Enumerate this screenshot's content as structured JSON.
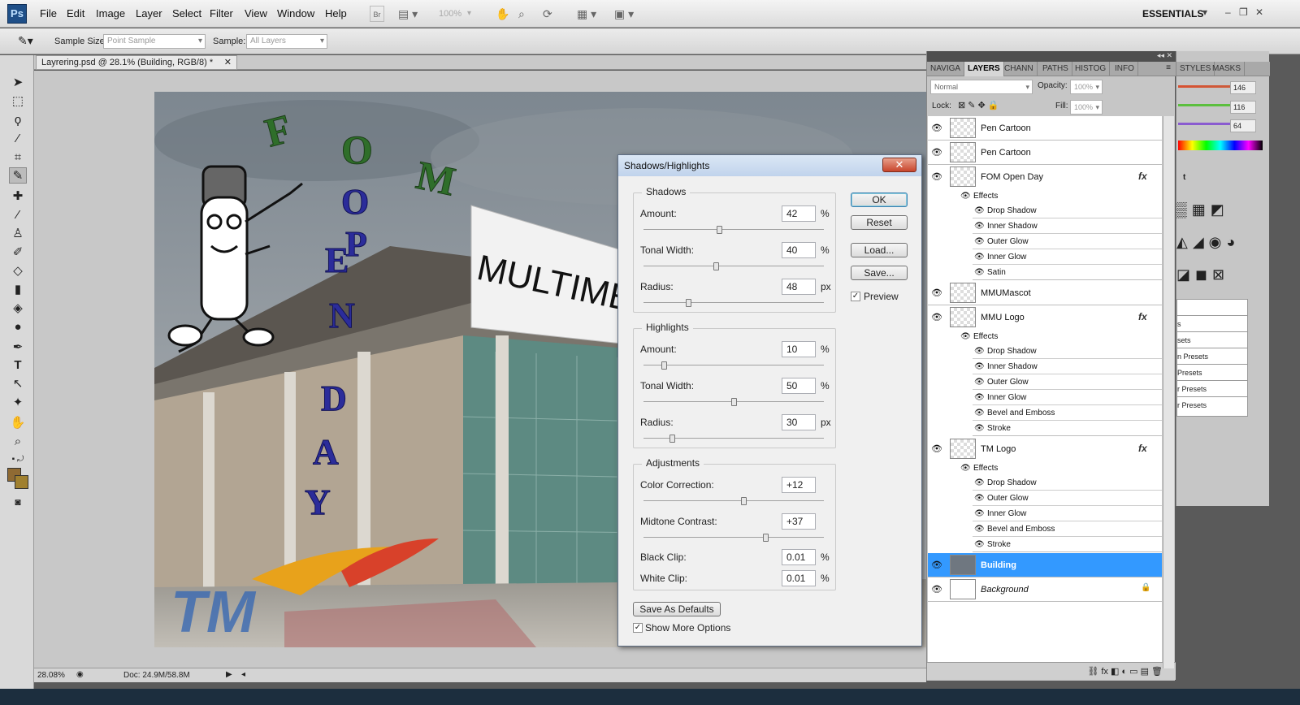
{
  "app": {
    "logo": "Ps"
  },
  "menu": [
    "File",
    "Edit",
    "Image",
    "Layer",
    "Select",
    "Filter",
    "View",
    "Window",
    "Help"
  ],
  "toolbar": {
    "zoom": "100%",
    "workspace": "ESSENTIALS"
  },
  "options": {
    "sample_size_label": "Sample Size:",
    "sample_size_value": "Point Sample",
    "sample_label": "Sample:",
    "sample_value": "All Layers"
  },
  "document": {
    "tab_title": "Layrering.psd @ 28.1% (Building, RGB/8) *",
    "zoom": "28.08%",
    "doc_info": "Doc: 24.9M/58.8M"
  },
  "canvas_text": {
    "fom": [
      "F",
      "O",
      "M"
    ],
    "open": [
      "O",
      "P",
      "E",
      "N"
    ],
    "day": [
      "D",
      "A",
      "Y"
    ],
    "sign": "MULTIMEDI",
    "logo": "TM"
  },
  "dialog": {
    "title": "Shadows/Highlights",
    "shadows": {
      "title": "Shadows",
      "rows": [
        {
          "label": "Amount:",
          "value": "42",
          "unit": "%",
          "level": 0.42
        },
        {
          "label": "Tonal Width:",
          "value": "40",
          "unit": "%",
          "level": 0.4
        },
        {
          "label": "Radius:",
          "value": "48",
          "unit": "px",
          "level": 0.24
        }
      ]
    },
    "highlights": {
      "title": "Highlights",
      "rows": [
        {
          "label": "Amount:",
          "value": "10",
          "unit": "%",
          "level": 0.1
        },
        {
          "label": "Tonal Width:",
          "value": "50",
          "unit": "%",
          "level": 0.5
        },
        {
          "label": "Radius:",
          "value": "30",
          "unit": "px",
          "level": 0.15
        }
      ]
    },
    "adjustments": {
      "title": "Adjustments",
      "rows": [
        {
          "label": "Color Correction:",
          "value": "+12",
          "unit": "",
          "level": 0.56
        },
        {
          "label": "Midtone Contrast:",
          "value": "+37",
          "unit": "",
          "level": 0.685
        },
        {
          "label": "Black Clip:",
          "value": "0.01",
          "unit": "%"
        },
        {
          "label": "White Clip:",
          "value": "0.01",
          "unit": "%"
        }
      ]
    },
    "buttons": {
      "ok": "OK",
      "reset": "Reset",
      "load": "Load...",
      "save": "Save..."
    },
    "preview_label": "Preview",
    "save_defaults": "Save As Defaults",
    "show_more": "Show More Options"
  },
  "panel": {
    "tabs": [
      "NAVIGA",
      "LAYERS",
      "CHANN",
      "PATHS",
      "HISTOG",
      "INFO"
    ],
    "right_tabs": [
      "STYLES",
      "MASKS"
    ],
    "blend_mode": "Normal",
    "opacity_label": "Opacity:",
    "opacity": "100%",
    "lock_label": "Lock:",
    "fill_label": "Fill:",
    "fill": "100%",
    "effects_label": "Effects",
    "layers": [
      {
        "name": "Pen Cartoon"
      },
      {
        "name": "Pen Cartoon"
      },
      {
        "name": "FOM Open Day",
        "fx": "fx",
        "effects": [
          "Drop Shadow",
          "Inner Shadow",
          "Outer Glow",
          "Inner Glow",
          "Satin"
        ]
      },
      {
        "name": "MMUMascot"
      },
      {
        "name": "MMU Logo",
        "fx": "fx",
        "effects": [
          "Drop Shadow",
          "Inner Shadow",
          "Outer Glow",
          "Inner Glow",
          "Bevel and Emboss",
          "Stroke"
        ]
      },
      {
        "name": "TM Logo",
        "fx": "fx",
        "effects": [
          "Drop Shadow",
          "Outer Glow",
          "Inner Glow",
          "Bevel and Emboss",
          "Stroke"
        ]
      },
      {
        "name": "Building",
        "selected": true
      },
      {
        "name": "Background",
        "italic": true,
        "locked": true
      }
    ],
    "color_values": [
      "146",
      "116",
      "64"
    ],
    "preset_items": [
      "s",
      "sets",
      "n Presets",
      "Presets",
      "r Presets",
      "r Presets"
    ]
  }
}
